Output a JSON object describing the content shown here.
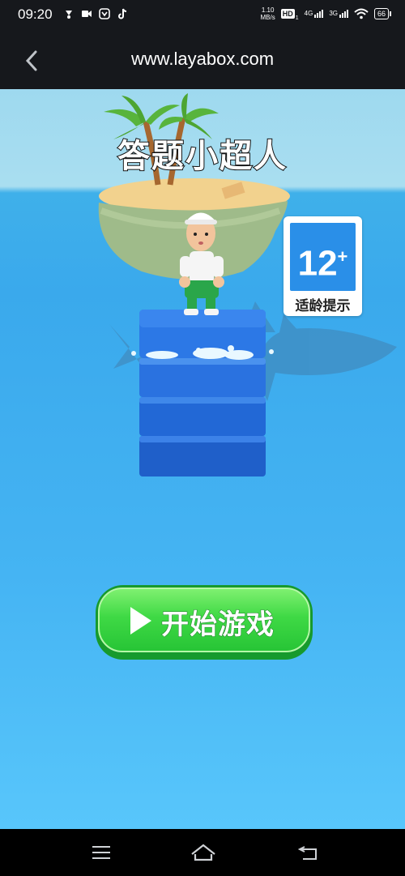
{
  "status_bar": {
    "time": "09:20",
    "left_icons": [
      "app-icon",
      "video-icon",
      "shield-icon",
      "tiktok-icon"
    ],
    "speed_value": "1.10",
    "speed_unit": "MB/s",
    "hd_label": "HD",
    "hd_sub": "1",
    "network_1": "4G",
    "network_2": "3G",
    "battery": "66"
  },
  "browser": {
    "url": "www.layabox.com"
  },
  "game": {
    "title": "答题小超人",
    "age_rating": "12",
    "age_rating_plus": "+",
    "age_label": "适龄提示",
    "start_button": "开始游戏"
  },
  "nav_bar": {
    "buttons": [
      "menu-icon",
      "home-icon",
      "back-icon"
    ]
  },
  "colors": {
    "header_bg": "#16181c",
    "sea": "#3aa9ec",
    "sky": "#a9def0",
    "start_button": "#3fd945",
    "age_badge": "#2a8fe8"
  }
}
